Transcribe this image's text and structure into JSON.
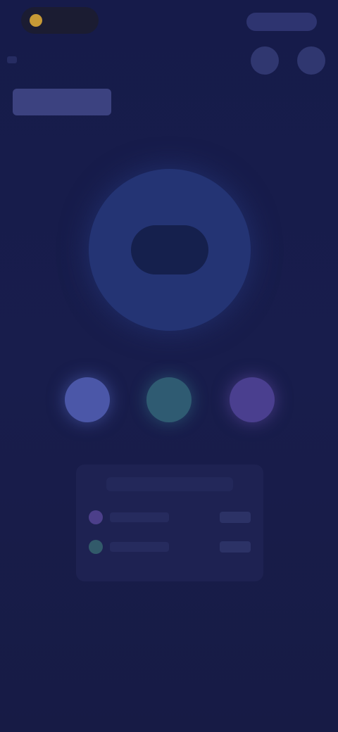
{
  "status_pill": {
    "text": ""
  },
  "top_label": {
    "text": ""
  },
  "header": {
    "title": ""
  },
  "dial": {
    "center_text": ""
  },
  "icons": {
    "button_1": "circle-icon",
    "button_2": "circle-icon",
    "action_1": "action-icon",
    "action_2": "action-icon",
    "action_3": "action-icon"
  },
  "card": {
    "heading": "",
    "rows": [
      {
        "label": "",
        "value": ""
      },
      {
        "label": "",
        "value": ""
      }
    ]
  },
  "colors": {
    "background": "#171c4a",
    "accent_gold": "#c79a36",
    "dial": "#243474",
    "action_1": "#4b57a8",
    "action_2": "#2f5b72",
    "action_3": "#4a3f8f"
  }
}
